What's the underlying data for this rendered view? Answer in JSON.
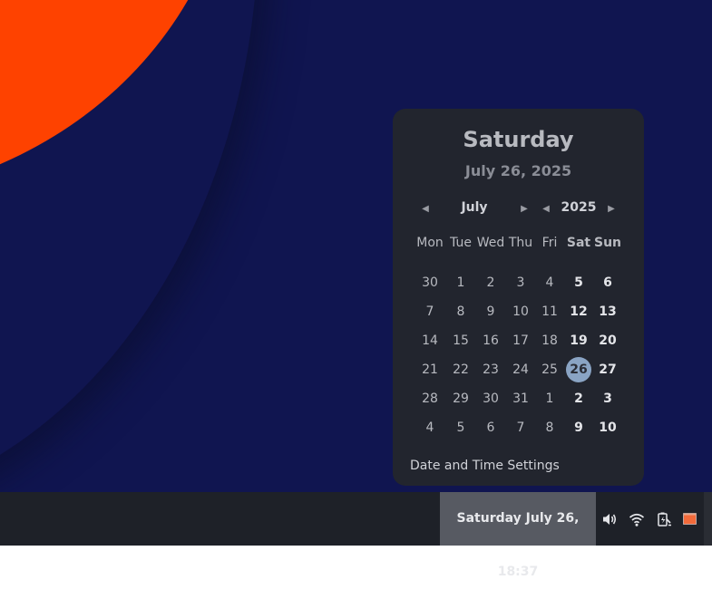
{
  "calendar": {
    "day_name": "Saturday",
    "full_date": "July 26, 2025",
    "month": "July",
    "year": "2025",
    "weekdays": [
      "Mon",
      "Tue",
      "Wed",
      "Thu",
      "Fri",
      "Sat",
      "Sun"
    ],
    "weeks": [
      [
        "30",
        "1",
        "2",
        "3",
        "4",
        "5",
        "6"
      ],
      [
        "7",
        "8",
        "9",
        "10",
        "11",
        "12",
        "13"
      ],
      [
        "14",
        "15",
        "16",
        "17",
        "18",
        "19",
        "20"
      ],
      [
        "21",
        "22",
        "23",
        "24",
        "25",
        "26",
        "27"
      ],
      [
        "28",
        "29",
        "30",
        "31",
        "1",
        "2",
        "3"
      ],
      [
        "4",
        "5",
        "6",
        "7",
        "8",
        "9",
        "10"
      ]
    ],
    "today": "26",
    "settings_label": "Date and Time Settings"
  },
  "taskbar": {
    "clock": "Saturday July 26, 18:37",
    "tray_icons": [
      "volume-icon",
      "wifi-icon",
      "battery-icon",
      "show-desktop-icon"
    ]
  },
  "colors": {
    "desktop_bg": "#101550",
    "accent_orange": "#fe4200",
    "popup_bg": "#22252e",
    "today_highlight": "#8aa4c4"
  }
}
